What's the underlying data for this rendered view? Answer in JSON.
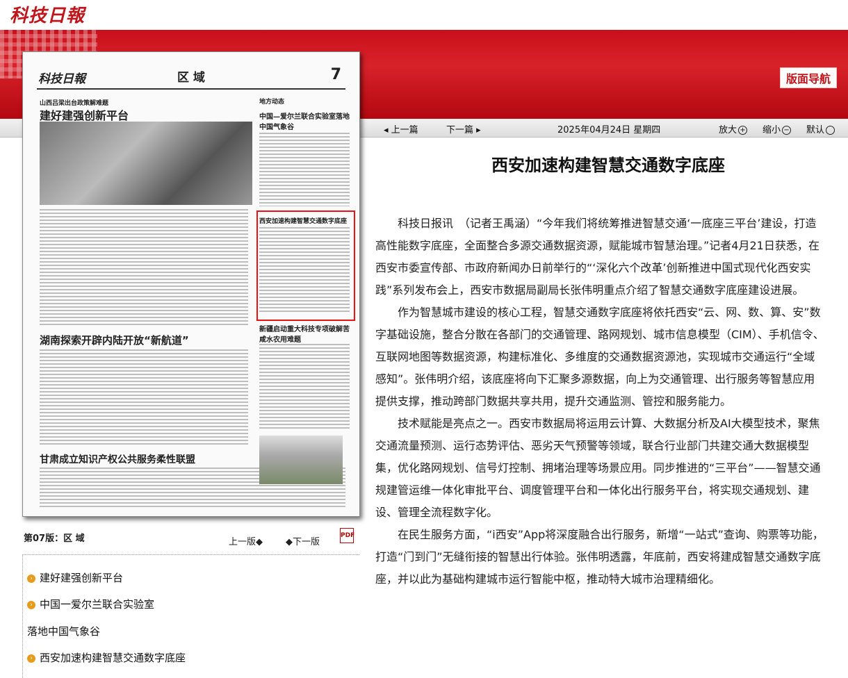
{
  "site": {
    "logo": "科技日報"
  },
  "banner": {
    "nav_label": "版面导航"
  },
  "toolbar": {
    "prev": "上一篇",
    "next": "下一篇",
    "date": "2025年04月24日 星期四",
    "zoom_in": "放大",
    "zoom_out": "缩小",
    "default": "默认"
  },
  "newspaper_page": {
    "paper_name": "科技日報",
    "section": "区 域",
    "page_number": "7",
    "kicker": "山西吕梁出台政策解难题",
    "headline_main": "建好建强创新平台",
    "headline_2": "湖南探索开辟内陆开放“新航道”",
    "headline_3": "甘肃成立知识产权公共服务柔性联盟",
    "right_col": "地方动态",
    "right_head_1": "中国—爱尔兰联合实验室落地中国气象谷",
    "right_head_2": "西安加速构建智慧交通数字底座",
    "right_head_3": "新疆启动重大科技专项破解苦咸水农用难题"
  },
  "edition_label": "第07版：区 域",
  "page_nav": {
    "prev": "上一版",
    "next": "下一版",
    "pdf": "PDF"
  },
  "article_list": [
    "建好建强创新平台",
    "中国一爱尔兰联合实验室",
    "落地中国气象谷",
    "西安加速构建智慧交通数字底座"
  ],
  "article": {
    "title": "西安加速构建智慧交通数字底座",
    "paragraphs": [
      "科技日报讯　（记者王禹涵）“今年我们将统筹推进智慧交通‘一底座三平台’建设，打造高性能数字底座，全面整合多源交通数据资源，赋能城市智慧治理。”记者4月21日获悉，在西安市委宣传部、市政府新闻办日前举行的“‘深化六个改革’创新推进中国式现代化西安实践”系列发布会上，西安市数据局副局长张伟明重点介绍了智慧交通数字底座建设进展。",
      "作为智慧城市建设的核心工程，智慧交通数字底座将依托西安“云、网、数、算、安”数字基础设施，整合分散在各部门的交通管理、路网规划、城市信息模型（CIM）、手机信令、互联网地图等数据资源，构建标准化、多维度的交通数据资源池，实现城市交通运行“全域感知”。张伟明介绍，该底座将向下汇聚多源数据，向上为交通管理、出行服务等智慧应用提供支撑，推动跨部门数据共享共用，提升交通监测、管控和服务能力。",
      "技术赋能是亮点之一。西安市数据局将运用云计算、大数据分析及AI大模型技术，聚焦交通流量预测、运行态势评估、恶劣天气预警等领域，联合行业部门共建交通大数据模型集，优化路网规划、信号灯控制、拥堵治理等场景应用。同步推进的“三平台”——智慧交通规建管运维一体化审批平台、调度管理平台和一体化出行服务平台，将实现交通规划、建设、管理全流程数字化。",
      "在民生服务方面，“i西安”App将深度融合出行服务，新增“一站式”查询、购票等功能，打造“门到门”无缝衔接的智慧出行体验。张伟明透露，年底前，西安将建成智慧交通数字底座，并以此为基础构建城市运行智能中枢，推动特大城市治理精细化。"
    ]
  }
}
